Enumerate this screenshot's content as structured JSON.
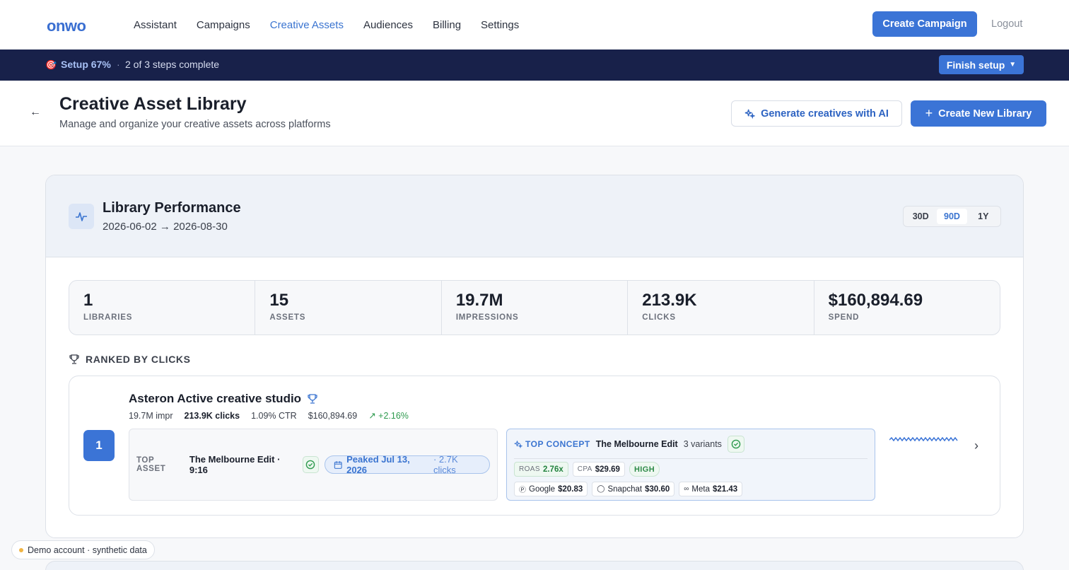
{
  "nav": {
    "logo": "onwo",
    "links": [
      "Assistant",
      "Campaigns",
      "Creative Assets",
      "Audiences",
      "Billing",
      "Settings"
    ],
    "active": "Creative Assets",
    "create_campaign": "Create Campaign",
    "logout": "Logout"
  },
  "setup": {
    "percent": "Setup 67%",
    "separator": "·",
    "steps": "2 of 3 steps complete",
    "finish": "Finish setup",
    "progress": 0.67
  },
  "header": {
    "title": "Creative Asset Library",
    "subtitle": "Manage and organize your creative assets across platforms",
    "ai_button": "Generate creatives with AI",
    "new_button": "Create New Library"
  },
  "performance": {
    "title": "Library Performance",
    "range": "2026-06-02 → 2026-08-30",
    "ranges": [
      "30D",
      "90D",
      "1Y"
    ],
    "active_range": "90D",
    "stats": [
      {
        "value": "1",
        "label": "LIBRARIES"
      },
      {
        "value": "15",
        "label": "ASSETS"
      },
      {
        "value": "19.7M",
        "label": "IMPRESSIONS"
      },
      {
        "value": "213.9K",
        "label": "CLICKS"
      },
      {
        "value": "$160,894.69",
        "label": "SPEND"
      }
    ],
    "ranked_label": "RANKED BY CLICKS"
  },
  "ranked": [
    {
      "rank": "1",
      "name": "Asteron Active creative studio",
      "impr": "19.7M impr",
      "clicks": "213.9K clicks",
      "ctr": "1.09% CTR",
      "spend": "$160,894.69",
      "trend": "+2.16%",
      "top_asset_label": "TOP ASSET",
      "top_asset_name": "The Melbourne Edit · 9:16",
      "peak": "Peaked Jul 13, 2026",
      "peak_clicks": "· 2.7K clicks",
      "top_concept_label": "TOP CONCEPT",
      "top_concept_name": "The Melbourne Edit",
      "variants": "3 variants",
      "roas_label": "ROAS",
      "roas": "2.76x",
      "cpa_label": "CPA",
      "cpa": "$29.69",
      "confidence": "HIGH",
      "platforms": [
        {
          "name": "Google",
          "cpa": "$20.83",
          "icon": "google-icon"
        },
        {
          "name": "Snapchat",
          "cpa": "$30.60",
          "icon": "snapchat-icon"
        },
        {
          "name": "Meta",
          "cpa": "$21.43",
          "icon": "meta-icon"
        }
      ]
    }
  ],
  "demo": "Demo account · synthetic data",
  "colors": {
    "primary": "#3b74d6",
    "navy": "#18214a",
    "success": "#2e9a4e"
  }
}
